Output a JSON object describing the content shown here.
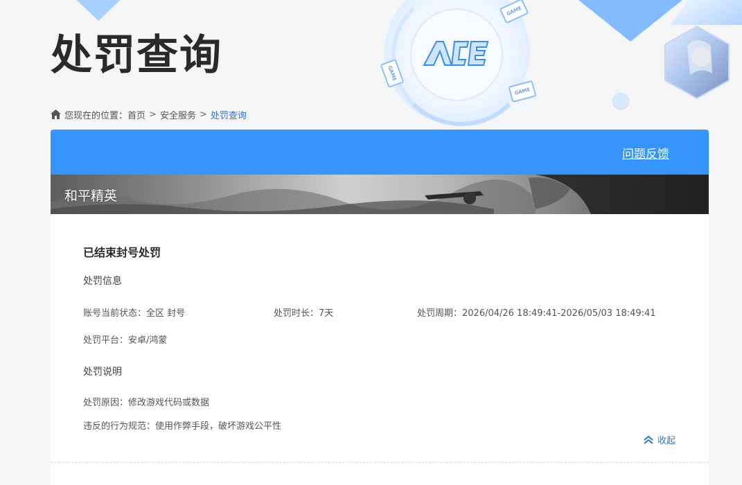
{
  "header": {
    "title": "处罚查询",
    "logo_text": "ACE",
    "game_tags": [
      "GAME",
      "GAME",
      "GAME"
    ]
  },
  "breadcrumb": {
    "prefix": "您现在的位置：",
    "items": [
      "首页",
      "安全服务",
      "处罚查询"
    ],
    "separator": ">"
  },
  "toolbar": {
    "feedback_label": "问题反馈"
  },
  "game": {
    "name": "和平精英"
  },
  "penalty": {
    "section_title": "已结束封号处罚",
    "info_heading": "处罚信息",
    "account_status": "账号当前状态：全区 封号",
    "duration": "处罚时长：7天",
    "period": "处罚周期：2026/04/26 18:49:41-2026/05/03 18:49:41",
    "platform": "处罚平台：安卓/鸿蒙",
    "explanation_heading": "处罚说明",
    "reason": "处罚原因：修改游戏代码或数据",
    "violation": "违反的行为规范：使用作弊手段，破坏游戏公平性",
    "collapse_label": "收起"
  },
  "colors": {
    "accent": "#3595fb",
    "link": "#2b78c5",
    "background": "#f4f5f7"
  },
  "icons": {
    "home": "home-icon",
    "collapse": "double-chevron-up-icon"
  }
}
